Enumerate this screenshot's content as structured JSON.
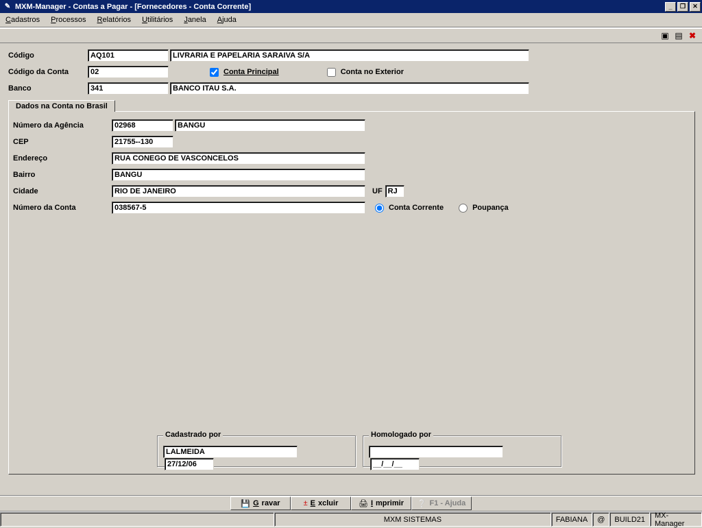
{
  "window": {
    "title": "MXM-Manager  -  Contas a Pagar - [Fornecedores - Conta Corrente]"
  },
  "menu": {
    "cadastros": "Cadastros",
    "processos": "Processos",
    "relatorios": "Relatórios",
    "utilitarios": "Utilitários",
    "janela": "Janela",
    "ajuda": "Ajuda"
  },
  "header": {
    "codigo_label": "Código",
    "codigo_value": "AQ101",
    "nome_value": "LIVRARIA E PAPELARIA SARAIVA S/A",
    "codigo_conta_label": "Código da Conta",
    "codigo_conta_value": "02",
    "conta_principal_label": "Conta Principal",
    "conta_principal_checked": true,
    "conta_exterior_label": "Conta no Exterior",
    "conta_exterior_checked": false,
    "banco_label": "Banco",
    "banco_value": "341",
    "banco_nome": "BANCO ITAU S.A."
  },
  "tab": {
    "label": "Dados na Conta no Brasil"
  },
  "brasil": {
    "agencia_label": "Número da Agência",
    "agencia_num": "02968",
    "agencia_nome": "BANGU",
    "cep_label": "CEP",
    "cep_value": "21755--130",
    "endereco_label": "Endereço",
    "endereco_value": "RUA CONEGO DE VASCONCELOS",
    "bairro_label": "Bairro",
    "bairro_value": "BANGU",
    "cidade_label": "Cidade",
    "cidade_value": "RIO DE JANEIRO",
    "uf_label": "UF",
    "uf_value": "RJ",
    "numconta_label": "Número da Conta",
    "numconta_value": "038567-5",
    "tipo_cc_label": "Conta Corrente",
    "tipo_cc_checked": true,
    "tipo_poup_label": "Poupança",
    "tipo_poup_checked": false
  },
  "footer": {
    "cadastrado_label": "Cadastrado por",
    "cadastrado_user": "LALMEIDA",
    "cadastrado_data": "27/12/06",
    "homologado_label": "Homologado por",
    "homologado_user": "",
    "homologado_data": "__/__/__"
  },
  "buttons": {
    "gravar": "Gravar",
    "excluir": "Excluir",
    "imprimir": "Imprimir",
    "ajuda": "F1 - Ajuda"
  },
  "status": {
    "sistema": "MXM SISTEMAS",
    "user": "FABIANA",
    "at": "@",
    "build": "BUILD21",
    "app": "MX-Manager"
  }
}
